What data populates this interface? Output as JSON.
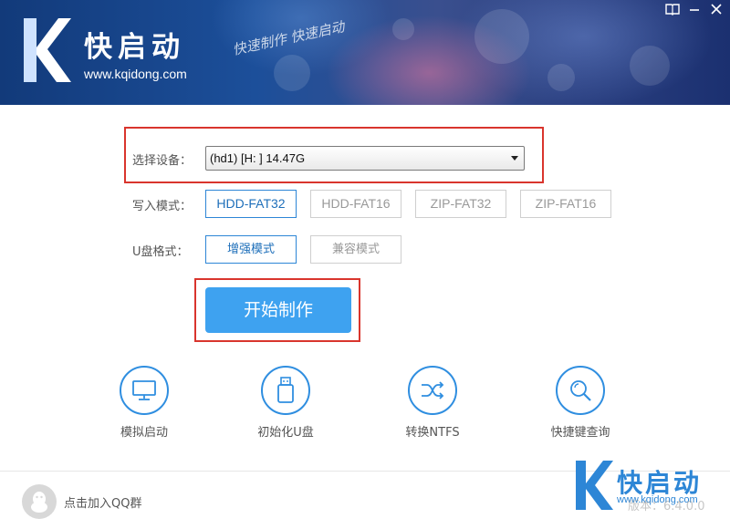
{
  "app": {
    "brand_name": "快启动",
    "brand_url": "www.kqidong.com",
    "slogan": "快速制作 快速启动"
  },
  "window_controls": [
    {
      "name": "book-icon",
      "glyph": "📖"
    },
    {
      "name": "minimize-icon",
      "glyph": "—"
    },
    {
      "name": "close-icon",
      "glyph": "✕"
    }
  ],
  "form": {
    "device_label": "选择设备：",
    "device_value": "(hd1) [H: ]  14.47G",
    "write_mode_label": "写入模式：",
    "write_modes": [
      {
        "label": "HDD-FAT32",
        "active": true
      },
      {
        "label": "HDD-FAT16",
        "active": false
      },
      {
        "label": "ZIP-FAT32",
        "active": false
      },
      {
        "label": "ZIP-FAT16",
        "active": false
      }
    ],
    "usb_format_label": "U盘格式：",
    "usb_formats": [
      {
        "label": "增强模式",
        "active": true
      },
      {
        "label": "兼容模式",
        "active": false
      }
    ],
    "start_button": "开始制作"
  },
  "tools": [
    {
      "label": "模拟启动",
      "icon": "monitor-icon"
    },
    {
      "label": "初始化U盘",
      "icon": "usb-drive-icon"
    },
    {
      "label": "转换NTFS",
      "icon": "shuffle-icon"
    },
    {
      "label": "快捷键查询",
      "icon": "search-icon"
    }
  ],
  "footer": {
    "qq_text": "点击加入QQ群",
    "logo_title": "快启动",
    "logo_url": "www.kqidong.com",
    "version": "版本：6.4.0.0"
  },
  "colors": {
    "accent": "#2d86d6",
    "button": "#3ea2f0",
    "highlight": "#d9352d"
  }
}
